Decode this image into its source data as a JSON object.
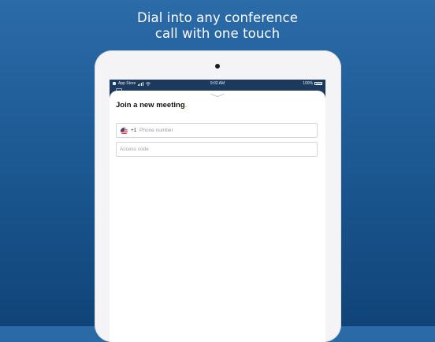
{
  "headline": {
    "line1": "Dial into any conference",
    "line2": "call with one touch"
  },
  "statusbar": {
    "carrier": "App Store",
    "time": "9:02 AM",
    "battery": "100%"
  },
  "sheet": {
    "title": "Join a new meeting",
    "title_accent": ".",
    "phone": {
      "country_flag": "us-flag-icon",
      "country_code": "+1",
      "placeholder": "Phone number",
      "value": ""
    },
    "access_code": {
      "placeholder": "Access code",
      "value": ""
    }
  },
  "colors": {
    "background_top": "#2b6ba8",
    "background_bottom": "#104478",
    "accent_dot": "#f0a11d",
    "app_header": "#1c3a5e"
  }
}
